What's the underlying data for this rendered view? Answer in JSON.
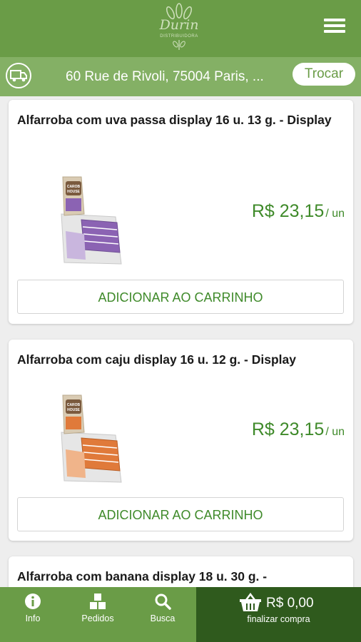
{
  "header": {
    "logo_text": "Durin",
    "logo_subtext": "DISTRIBUIDORA"
  },
  "delivery": {
    "address": "60 Rue de Rivoli, 75004 Paris, ...",
    "change_label": "Trocar"
  },
  "products": [
    {
      "title": "Alfarroba com uva passa display 16 u. 13 g. - Display",
      "price": "R$ 23,15",
      "unit": "/ un",
      "add_label": "ADICIONAR AO CARRINHO",
      "box_brand": "CAROB HOUSE",
      "accent_color": "#8b63b3"
    },
    {
      "title": "Alfarroba com caju display 16 u. 12 g. - Display",
      "price": "R$ 23,15",
      "unit": "/ un",
      "add_label": "ADICIONAR AO CARRINHO",
      "box_brand": "CAROB HOUSE",
      "accent_color": "#e07a3a"
    },
    {
      "title": "Alfarroba com banana display 18 u. 30 g. -"
    }
  ],
  "bottom_nav": {
    "info_label": "Info",
    "orders_label": "Pedidos",
    "search_label": "Busca",
    "cart_total": "R$ 0,00",
    "checkout_label": "finalizar compra"
  },
  "colors": {
    "header_green": "#6a9c47",
    "address_green": "#84b065",
    "price_green": "#3f8a2a",
    "checkout_dark": "#2f5a1d"
  }
}
